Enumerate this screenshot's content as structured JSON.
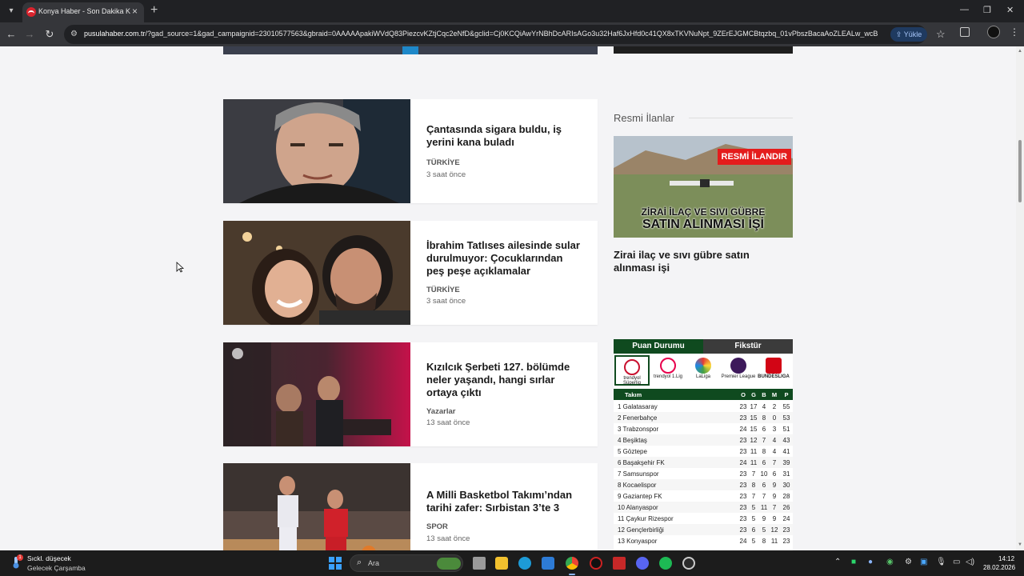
{
  "browser": {
    "tab_title": "Konya Haber - Son Dakika Konya",
    "url_domain": "pusulahaber.com.tr",
    "url_rest": "/?gad_source=1&gad_campaignid=23010577563&gbraid=0AAAAApakiWVdQ83PiezcvKZtjCqc2eNfD&gclid=Cj0KCQiAwYrNBhDcARIsAGo3u32Haf6JxHfd0c41QX8xTKVNuNpt_9ZErEJGMCBtqzbq_01vPbszBacaAoZLEALw_wcB",
    "install_label": "Yükle"
  },
  "news": [
    {
      "title": "Çantasında sigara buldu, iş yerini kana buladı",
      "category": "TÜRKİYE",
      "time": "3 saat önce"
    },
    {
      "title": "İbrahim Tatlıses ailesinde sular durulmuyor: Çocuklarından peş peşe açıklamalar",
      "category": "TÜRKİYE",
      "time": "3 saat önce"
    },
    {
      "title": "Kızılcık Şerbeti 127. bölümde neler yaşandı, hangi sırlar ortaya çıktı",
      "category": "Yazarlar",
      "time": "13 saat önce"
    },
    {
      "title": "A Milli Basketbol Takımı’ndan tarihi zafer: Sırbistan 3’te 3",
      "category": "SPOR",
      "time": "13 saat önce"
    }
  ],
  "sidebar": {
    "heading": "Resmi İlanlar",
    "ilan_badge": "RESMİ İLANDIR",
    "ilan_line1": "ZİRAİ İLAÇ VE SIVI GÜBRE",
    "ilan_line2": "SATIN ALINMASI İŞİ",
    "ilan_caption": "Zirai ilaç ve sıvı gübre satın alınması işi"
  },
  "standings": {
    "tabs": [
      "Puan Durumu",
      "Fikstür"
    ],
    "leagues": [
      "trendyol Süperlig",
      "trendyol 1.Lig",
      "LaLiga",
      "Premier League",
      "BUNDESLIGA"
    ],
    "columns": [
      "Takım",
      "O",
      "G",
      "B",
      "M",
      "P"
    ],
    "rows": [
      [
        "1 Galatasaray",
        "23",
        "17",
        "4",
        "2",
        "55"
      ],
      [
        "2 Fenerbahçe",
        "23",
        "15",
        "8",
        "0",
        "53"
      ],
      [
        "3 Trabzonspor",
        "24",
        "15",
        "6",
        "3",
        "51"
      ],
      [
        "4 Beşiktaş",
        "23",
        "12",
        "7",
        "4",
        "43"
      ],
      [
        "5 Göztepe",
        "23",
        "11",
        "8",
        "4",
        "41"
      ],
      [
        "6 Başakşehir FK",
        "24",
        "11",
        "6",
        "7",
        "39"
      ],
      [
        "7 Samsunspor",
        "23",
        "7",
        "10",
        "6",
        "31"
      ],
      [
        "8 Kocaelispor",
        "23",
        "8",
        "6",
        "9",
        "30"
      ],
      [
        "9 Gaziantep FK",
        "23",
        "7",
        "7",
        "9",
        "28"
      ],
      [
        "10 Alanyaspor",
        "23",
        "5",
        "11",
        "7",
        "26"
      ],
      [
        "11 Çaykur Rizespor",
        "23",
        "5",
        "9",
        "9",
        "24"
      ],
      [
        "12 Gençlerbirliği",
        "23",
        "6",
        "5",
        "12",
        "23"
      ],
      [
        "13 Konyaspor",
        "24",
        "5",
        "8",
        "11",
        "23"
      ]
    ]
  },
  "taskbar": {
    "weather_title": "Sıckl. düşecek",
    "weather_sub": "Gelecek Çarşamba",
    "weather_badge": "1",
    "search_label": "Ara",
    "time": "14:12",
    "date": "28.02.2026"
  },
  "colors": {
    "brand_red": "#d9232d",
    "standings_green": "#0f4a1f"
  }
}
